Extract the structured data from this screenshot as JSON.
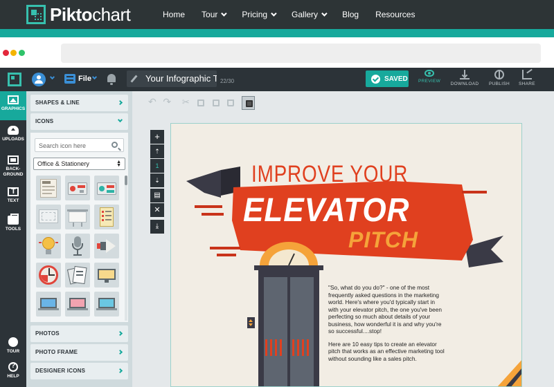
{
  "site": {
    "logo_bold": "Pikto",
    "logo_light": "chart",
    "nav": [
      {
        "label": "Home"
      },
      {
        "label": "Tour"
      },
      {
        "label": "Pricing"
      },
      {
        "label": "Gallery"
      },
      {
        "label": "Blog"
      },
      {
        "label": "Resources"
      }
    ]
  },
  "app": {
    "file_label": "File",
    "title": "Your Infographic Title",
    "title_count": "22/30",
    "saved_label": "SAVED",
    "actions": [
      {
        "label": "PREVIEW",
        "icon": "eye-icon"
      },
      {
        "label": "DOWNLOAD",
        "icon": "download-icon"
      },
      {
        "label": "PUBLISH",
        "icon": "globe-icon"
      },
      {
        "label": "SHARE",
        "icon": "share-icon"
      }
    ]
  },
  "rail": {
    "items": [
      {
        "label_1": "GRAPHICS",
        "label_2": "",
        "icon": "graphics-icon"
      },
      {
        "label_1": "UPLOADS",
        "label_2": "",
        "icon": "upload-icon"
      },
      {
        "label_1": "BACK-",
        "label_2": "GROUND",
        "icon": "background-icon"
      },
      {
        "label_1": "TEXT",
        "label_2": "",
        "icon": "text-icon"
      },
      {
        "label_1": "TOOLS",
        "label_2": "",
        "icon": "tools-icon"
      }
    ],
    "bottom": [
      {
        "label": "TOUR",
        "icon": "tour-icon"
      },
      {
        "label": "HELP",
        "icon": "help-icon"
      }
    ]
  },
  "panel": {
    "shapes_label": "SHAPES & LINE",
    "icons_label": "ICONS",
    "search_placeholder": "Search icon here",
    "category": "Office & Stationery",
    "icon_names": [
      "newspaper",
      "radio",
      "radio-teal",
      "monitor-frame",
      "projector-screen",
      "clipboard-list",
      "light-bulb",
      "microphone",
      "megaphone",
      "clock-chart",
      "documents",
      "monitor-yellow",
      "laptop-blue",
      "laptop-pink",
      "laptop-teal"
    ],
    "photos_label": "PHOTOS",
    "photo_frame_label": "PHOTO FRAME",
    "designer_icons_label": "DESIGNER ICONS"
  },
  "canvas": {
    "page_number": "1",
    "headline_1": "IMPROVE YOUR",
    "headline_2": "ELEVATOR",
    "headline_3": "PITCH",
    "paragraph_1": "\"So, what do you do?\" - one of the most frequently asked questions in the marketing world. Here's where you'd typically start in with your elevator pitch, the one you've been perfecting so much about details of your business, how wonderful it is and why you're so successful....stop!",
    "paragraph_2": "Here are 10 easy tips to create an elevator pitch that works as an effective marketing tool without sounding like a sales pitch."
  },
  "colors": {
    "teal": "#17a99c",
    "dark": "#2c3338",
    "ribbon_red": "#e0401f",
    "ribbon_dark": "#3a3a46",
    "pitch_orange": "#f5a33a"
  }
}
